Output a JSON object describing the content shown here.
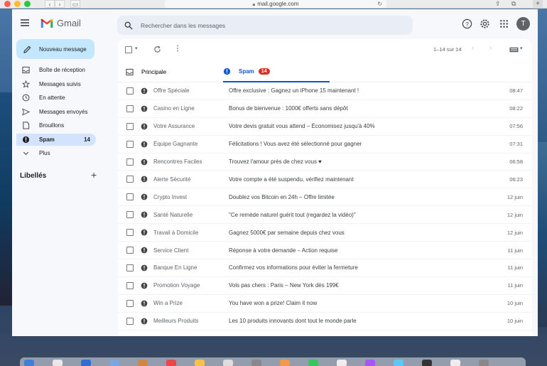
{
  "browser": {
    "url": "mail.google.com"
  },
  "app": {
    "name": "Gmail",
    "avatar_letter": "T"
  },
  "search": {
    "placeholder": "Rechercher dans les messages"
  },
  "compose": {
    "label": "Nouveau message"
  },
  "sidebar": {
    "items": [
      {
        "label": "Boîte de réception",
        "icon": "inbox-icon",
        "count": ""
      },
      {
        "label": "Messages suivis",
        "icon": "star-icon",
        "count": ""
      },
      {
        "label": "En attente",
        "icon": "clock-icon",
        "count": ""
      },
      {
        "label": "Messages envoyés",
        "icon": "send-icon",
        "count": ""
      },
      {
        "label": "Brouillons",
        "icon": "draft-icon",
        "count": ""
      },
      {
        "label": "Spam",
        "icon": "spam-icon",
        "count": "14"
      },
      {
        "label": "Plus",
        "icon": "chevron-down-icon",
        "count": ""
      }
    ],
    "labels_title": "Libellés",
    "labels_add": "+"
  },
  "toolbar": {
    "pagination": "1–14 sur 14"
  },
  "tabs": [
    {
      "label": "Principale",
      "active": false
    },
    {
      "label": "Spam",
      "active": true,
      "badge": "14"
    }
  ],
  "emails": [
    {
      "sender": "Offre Spéciale",
      "subject": "Offre exclusive : Gagnez un iPhone 15 maintenant !",
      "time": "08:47"
    },
    {
      "sender": "Casino en Ligne",
      "subject": "Bonus de bienvenue : 1000€ offerts sans dépôt",
      "time": "08:22"
    },
    {
      "sender": "Votre Assurance",
      "subject": "Votre devis gratuit vous attend – Économisez jusqu'à 40%",
      "time": "07:56"
    },
    {
      "sender": "Équipe Gagnante",
      "subject": "Félicitations ! Vous avez été sélectionné pour gagner",
      "time": "07:31"
    },
    {
      "sender": "Rencontres Faciles",
      "subject": "Trouvez l'amour près de chez vous ♥",
      "time": "06:58"
    },
    {
      "sender": "Alerte Sécurité",
      "subject": "Votre compte a été suspendu, vérifiez maintenant",
      "time": "06:23"
    },
    {
      "sender": "Crypto Invest",
      "subject": "Doublez vos Bitcoin en 24h – Offre limitée",
      "time": "12 juin"
    },
    {
      "sender": "Santé Naturelle",
      "subject": "\"Ce remède naturel guérit tout (regardez la vidéo)\"",
      "time": "12 juin"
    },
    {
      "sender": "Travail à Domicile",
      "subject": "Gagnez 5000€ par semaine depuis chez vous",
      "time": "12 juin"
    },
    {
      "sender": "Service Client",
      "subject": "Réponse à votre demande – Action requise",
      "time": "11 juin"
    },
    {
      "sender": "Banque En Ligne",
      "subject": "Confirmez vos informations pour éviter la fermeture",
      "time": "11 juin"
    },
    {
      "sender": "Promotion Voyage",
      "subject": "Vols pas chers : Paris – New York dès 199€",
      "time": "11 juin"
    },
    {
      "sender": "Win a Prize",
      "subject": "You have won a prize! Claim it now",
      "time": "10 juin"
    },
    {
      "sender": "Meilleurs Produits",
      "subject": "Les 10 produits innovants dont tout le monde parle",
      "time": "10 juin"
    }
  ],
  "colors": {
    "compose_bg": "#c2e7ff",
    "active_nav": "#d3e3fd",
    "accent_blue": "#0b57d0",
    "badge_red": "#d93025"
  }
}
